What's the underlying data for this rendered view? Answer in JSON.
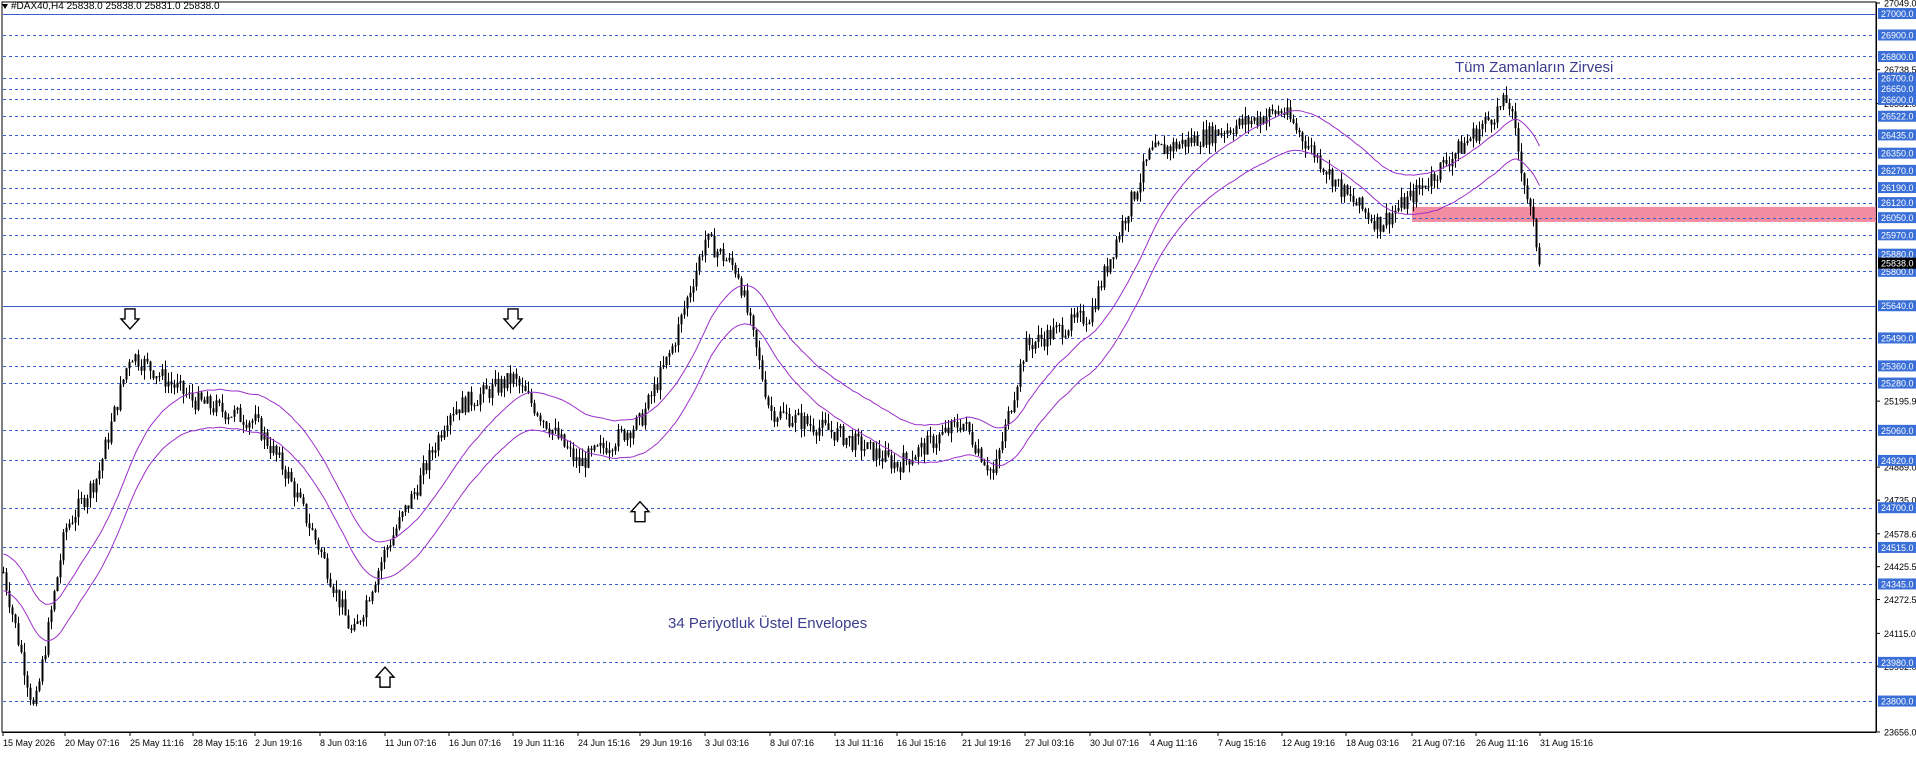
{
  "header": {
    "symbol_line": "#DAX40,H4  25838.0 25838.0 25831.0 25838.0"
  },
  "chart_data": {
    "type": "candlestick",
    "symbol": "#DAX40",
    "timeframe": "H4",
    "ylim": [
      23656.0,
      27049.0
    ],
    "colors": {
      "candle": "#000000",
      "envelope": "#9b30c8",
      "level": "#3a5fcd",
      "level_label_bg": "#3a6fd8",
      "zone": "#f07890",
      "annotation": "#3c3c8c"
    },
    "y_tick_labels": [
      {
        "value": 27049.0,
        "text": "27049.0"
      },
      {
        "value": 26738.5,
        "text": "26738.5"
      },
      {
        "value": 26581.0,
        "text": "26581.0"
      },
      {
        "value": 25195.9,
        "text": "25195.9"
      },
      {
        "value": 24889.0,
        "text": "24889.0"
      },
      {
        "value": 24735.0,
        "text": "24735.0"
      },
      {
        "value": 24578.6,
        "text": "24578.6"
      },
      {
        "value": 24425.5,
        "text": "24425.5"
      },
      {
        "value": 24272.5,
        "text": "24272.5"
      },
      {
        "value": 24115.0,
        "text": "24115.0"
      },
      {
        "value": 23962.0,
        "text": "23962.0"
      },
      {
        "value": 23656.0,
        "text": "23656.0"
      }
    ],
    "levels": [
      {
        "value": 27000.0,
        "text": "27000.0",
        "style": "solid"
      },
      {
        "value": 26900.0,
        "text": "26900.0",
        "style": "dashed"
      },
      {
        "value": 26800.0,
        "text": "26800.0",
        "style": "dashed"
      },
      {
        "value": 26700.0,
        "text": "26700.0",
        "style": "dashed"
      },
      {
        "value": 26650.0,
        "text": "26650.0",
        "style": "dashed"
      },
      {
        "value": 26600.0,
        "text": "26600.0",
        "style": "dashed"
      },
      {
        "value": 26522.0,
        "text": "26522.0",
        "style": "dashed"
      },
      {
        "value": 26435.0,
        "text": "26435.0",
        "style": "dashed"
      },
      {
        "value": 26350.0,
        "text": "26350.0",
        "style": "dashed"
      },
      {
        "value": 26270.0,
        "text": "26270.0",
        "style": "dashed"
      },
      {
        "value": 26190.0,
        "text": "26190.0",
        "style": "dashed"
      },
      {
        "value": 26120.0,
        "text": "26120.0",
        "style": "dashed"
      },
      {
        "value": 26050.0,
        "text": "26050.0",
        "style": "dashed"
      },
      {
        "value": 25970.0,
        "text": "25970.0",
        "style": "dashed"
      },
      {
        "value": 25880.0,
        "text": "25880.0",
        "style": "dashed"
      },
      {
        "value": 25800.0,
        "text": "25800.0",
        "style": "dashed"
      },
      {
        "value": 25640.0,
        "text": "25640.0",
        "style": "solid"
      },
      {
        "value": 25490.0,
        "text": "25490.0",
        "style": "dashed"
      },
      {
        "value": 25360.0,
        "text": "25360.0",
        "style": "dashed"
      },
      {
        "value": 25280.0,
        "text": "25280.0",
        "style": "dashed"
      },
      {
        "value": 25060.0,
        "text": "25060.0",
        "style": "dashed"
      },
      {
        "value": 24920.0,
        "text": "24920.0",
        "style": "dashed"
      },
      {
        "value": 24700.0,
        "text": "24700.0",
        "style": "dashed"
      },
      {
        "value": 24515.0,
        "text": "24515.0",
        "style": "dashed"
      },
      {
        "value": 24345.0,
        "text": "24345.0",
        "style": "dashed"
      },
      {
        "value": 23980.0,
        "text": "23980.0",
        "style": "dashed"
      },
      {
        "value": 23800.0,
        "text": "23800.0",
        "style": "dashed"
      }
    ],
    "current_price": {
      "value": 25838.0,
      "text": "25838.0"
    },
    "resistance_zone": {
      "from": 26030.0,
      "to": 26100.0,
      "start_label": "21 Aug 07:16"
    },
    "x_tick_labels": [
      "15 May 2026",
      "20 May 07:16",
      "25 May 11:16",
      "28 May 15:16",
      "2 Jun 19:16",
      "8 Jun 03:16",
      "11 Jun 07:16",
      "16 Jun 07:16",
      "19 Jun 11:16",
      "24 Jun 15:16",
      "29 Jun 19:16",
      "3 Jul 03:16",
      "8 Jul 07:16",
      "13 Jul 11:16",
      "16 Jul 15:16",
      "21 Jul 19:16",
      "27 Jul 03:16",
      "30 Jul 07:16",
      "4 Aug 11:16",
      "7 Aug 15:16",
      "12 Aug 19:16",
      "18 Aug 03:16",
      "21 Aug 07:16",
      "26 Aug 11:16",
      "31 Aug 15:16"
    ],
    "price_path": [
      {
        "x": "15 May 2026",
        "y": 24400
      },
      {
        "x": "16 May",
        "y": 23750
      },
      {
        "x": "20 May 07:16",
        "y": 24600
      },
      {
        "x": "22 May",
        "y": 24850
      },
      {
        "x": "25 May 11:16",
        "y": 25420
      },
      {
        "x": "28 May 15:16",
        "y": 25200
      },
      {
        "x": "2 Jun 19:16",
        "y": 25100
      },
      {
        "x": "5 Jun",
        "y": 24850
      },
      {
        "x": "8 Jun 03:16",
        "y": 24500
      },
      {
        "x": "10 Jun",
        "y": 24100
      },
      {
        "x": "11 Jun 07:16",
        "y": 24500
      },
      {
        "x": "13 Jun",
        "y": 24800
      },
      {
        "x": "16 Jun 07:16",
        "y": 25150
      },
      {
        "x": "19 Jun 11:16",
        "y": 25300
      },
      {
        "x": "22 Jun",
        "y": 25100
      },
      {
        "x": "24 Jun 15:16",
        "y": 24900
      },
      {
        "x": "29 Jun 19:16",
        "y": 25100
      },
      {
        "x": "1 Jul",
        "y": 25450
      },
      {
        "x": "3 Jul 03:16",
        "y": 25950
      },
      {
        "x": "6 Jul",
        "y": 25800
      },
      {
        "x": "8 Jul 07:16",
        "y": 25150
      },
      {
        "x": "13 Jul 11:16",
        "y": 25050
      },
      {
        "x": "16 Jul 15:16",
        "y": 24900
      },
      {
        "x": "21 Jul 19:16",
        "y": 25100
      },
      {
        "x": "23 Jul",
        "y": 24850
      },
      {
        "x": "27 Jul 03:16",
        "y": 25450
      },
      {
        "x": "30 Jul 07:16",
        "y": 25600
      },
      {
        "x": "1 Aug",
        "y": 26000
      },
      {
        "x": "4 Aug 11:16",
        "y": 26350
      },
      {
        "x": "7 Aug 15:16",
        "y": 26450
      },
      {
        "x": "12 Aug 19:16",
        "y": 26550
      },
      {
        "x": "18 Aug 03:16",
        "y": 26150
      },
      {
        "x": "20 Aug",
        "y": 26020
      },
      {
        "x": "21 Aug 07:16",
        "y": 26150
      },
      {
        "x": "26 Aug 11:16",
        "y": 26450
      },
      {
        "x": "28 Aug",
        "y": 26600
      },
      {
        "x": "31 Aug 15:16",
        "y": 25838
      }
    ],
    "annotations": [
      {
        "text": "Tüm Zamanların Zirvesi"
      },
      {
        "text": "34 Periyotluk Üstel Envelopes"
      }
    ],
    "arrows": [
      {
        "direction": "down",
        "x": "25 May 11:16",
        "y": 25560
      },
      {
        "direction": "down",
        "x": "19 Jun 11:16",
        "y": 25560
      },
      {
        "direction": "up",
        "x": "29 Jun 19:16",
        "y": 24700
      },
      {
        "direction": "up",
        "x": "11 Jun 07:16",
        "y": 23930
      }
    ]
  }
}
